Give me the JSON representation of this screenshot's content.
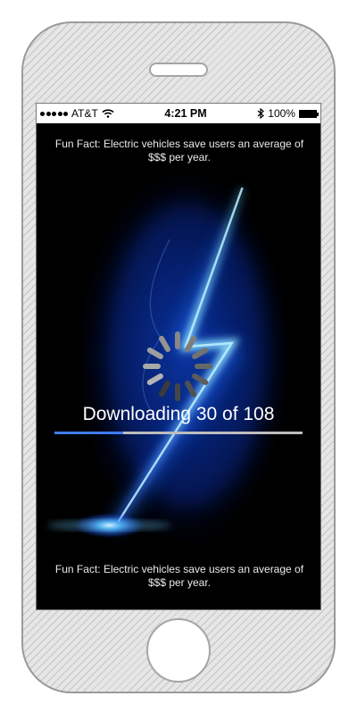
{
  "status_bar": {
    "carrier": "AT&T",
    "time": "4:21 PM",
    "battery": "100%"
  },
  "fun_fact_top": "Fun Fact: Electric vehicles save users an average of $$$ per year.",
  "fun_fact_bottom": "Fun Fact: Electric vehicles save users an average of $$$ per year.",
  "download": {
    "label": "Downloading 30 of 108",
    "current": 30,
    "total": 108
  },
  "icons": [
    "signal-icon",
    "wifi-icon",
    "bluetooth-icon",
    "battery-icon",
    "spinner-icon",
    "lightning-bolt-icon"
  ],
  "colors": {
    "progress_fill": "#3d7bff",
    "progress_track": "#bdbdbd",
    "background_glow": "#0c2f85"
  }
}
